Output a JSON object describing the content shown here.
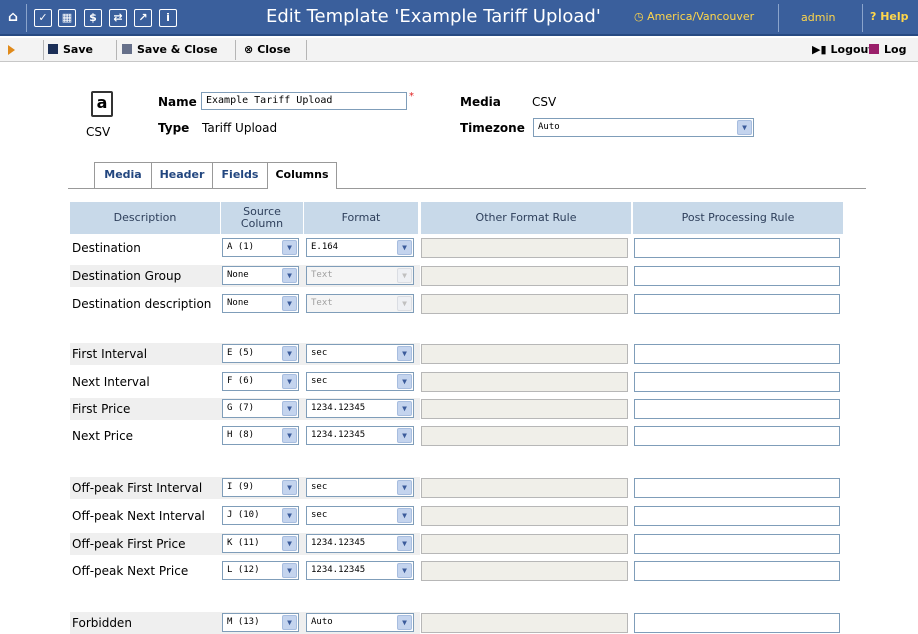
{
  "topbar": {
    "title": "Edit Template 'Example Tariff Upload'",
    "timezone": "America/Vancouver",
    "user": "admin",
    "help": "Help"
  },
  "toolbar": {
    "save": "Save",
    "save_close": "Save & Close",
    "close": "Close",
    "logout": "Logout",
    "log": "Log"
  },
  "form": {
    "file_icon_label": "CSV",
    "name_label": "Name",
    "name_value": "Example Tariff Upload",
    "type_label": "Type",
    "type_value": "Tariff Upload",
    "media_label": "Media",
    "media_value": "CSV",
    "timezone_label": "Timezone",
    "timezone_value": "Auto"
  },
  "tabs": [
    "Media",
    "Header",
    "Fields",
    "Columns"
  ],
  "table": {
    "headers": [
      "Description",
      "Source Column",
      "Format",
      "Other Format Rule",
      "Post Processing Rule"
    ],
    "rows": [
      {
        "description": "Destination",
        "source": "A (1)",
        "format": "E.164",
        "format_disabled": false
      },
      {
        "description": "Destination Group",
        "source": "None",
        "format": "Text",
        "format_disabled": true
      },
      {
        "description": "Destination description",
        "source": "None",
        "format": "Text",
        "format_disabled": true
      },
      {
        "description": "First Interval",
        "source": "E (5)",
        "format": "sec",
        "format_disabled": false
      },
      {
        "description": "Next Interval",
        "source": "F (6)",
        "format": "sec",
        "format_disabled": false
      },
      {
        "description": "First Price",
        "source": "G (7)",
        "format": "1234.12345",
        "format_disabled": false
      },
      {
        "description": "Next Price",
        "source": "H (8)",
        "format": "1234.12345",
        "format_disabled": false
      },
      {
        "description": "Off-peak First Interval",
        "source": "I (9)",
        "format": "sec",
        "format_disabled": false
      },
      {
        "description": "Off-peak Next Interval",
        "source": "J (10)",
        "format": "sec",
        "format_disabled": false
      },
      {
        "description": "Off-peak First Price",
        "source": "K (11)",
        "format": "1234.12345",
        "format_disabled": false
      },
      {
        "description": "Off-peak Next Price",
        "source": "L (12)",
        "format": "1234.12345",
        "format_disabled": false
      },
      {
        "description": "Forbidden",
        "source": "M (13)",
        "format": "Auto",
        "format_disabled": false
      }
    ]
  }
}
